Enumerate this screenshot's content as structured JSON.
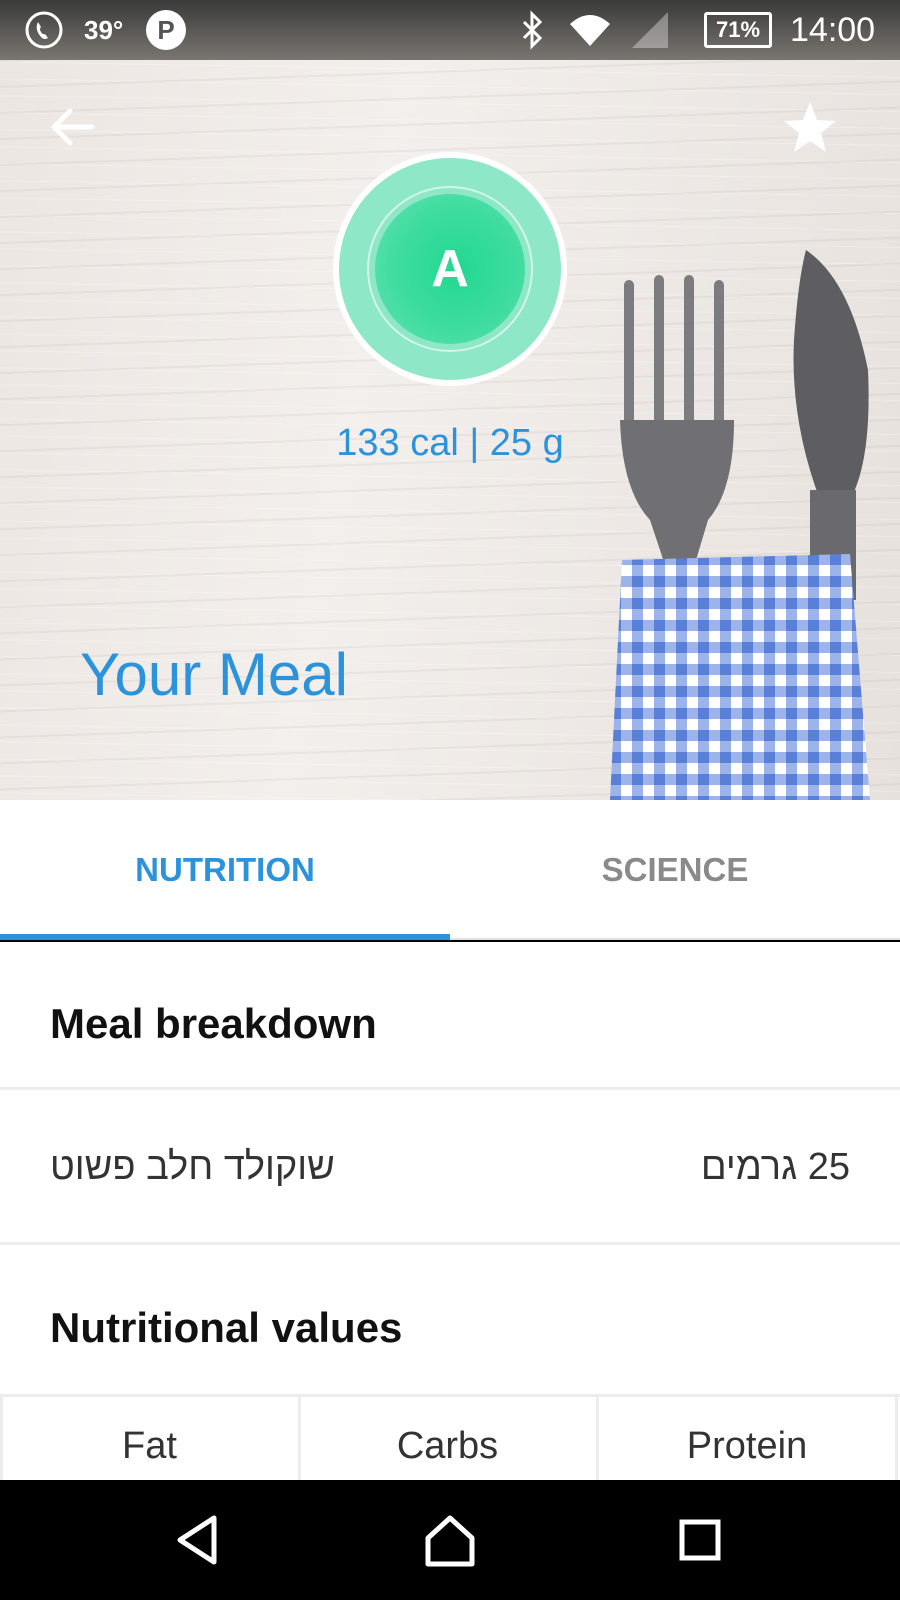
{
  "status_bar": {
    "temperature": "39°",
    "parking_badge": "P",
    "battery": "71%",
    "time": "14:00",
    "icons": [
      "call-icon",
      "parking-icon",
      "bluetooth-icon",
      "wifi-icon",
      "signal-icon",
      "battery-icon"
    ]
  },
  "header": {
    "grade": "A",
    "summary": "133 cal | 25 g",
    "title": "Your Meal",
    "icons": [
      "back-arrow-icon",
      "star-icon"
    ]
  },
  "tabs": [
    {
      "label": "NUTRITION",
      "active": true
    },
    {
      "label": "SCIENCE",
      "active": false
    }
  ],
  "breakdown": {
    "title": "Meal breakdown",
    "items": [
      {
        "name": "שוקולד חלב פשוט",
        "amount": "25 גרמים"
      }
    ]
  },
  "nutritional_values": {
    "title": "Nutritional values",
    "columns": [
      "Fat",
      "Carbs",
      "Protein"
    ]
  },
  "nav_bar": {
    "icons": [
      "back-triangle-icon",
      "home-icon",
      "recents-icon"
    ]
  },
  "colors": {
    "accent": "#2b93dc",
    "grade_green": "#22d891",
    "inactive_tab": "#8a8a8a"
  }
}
